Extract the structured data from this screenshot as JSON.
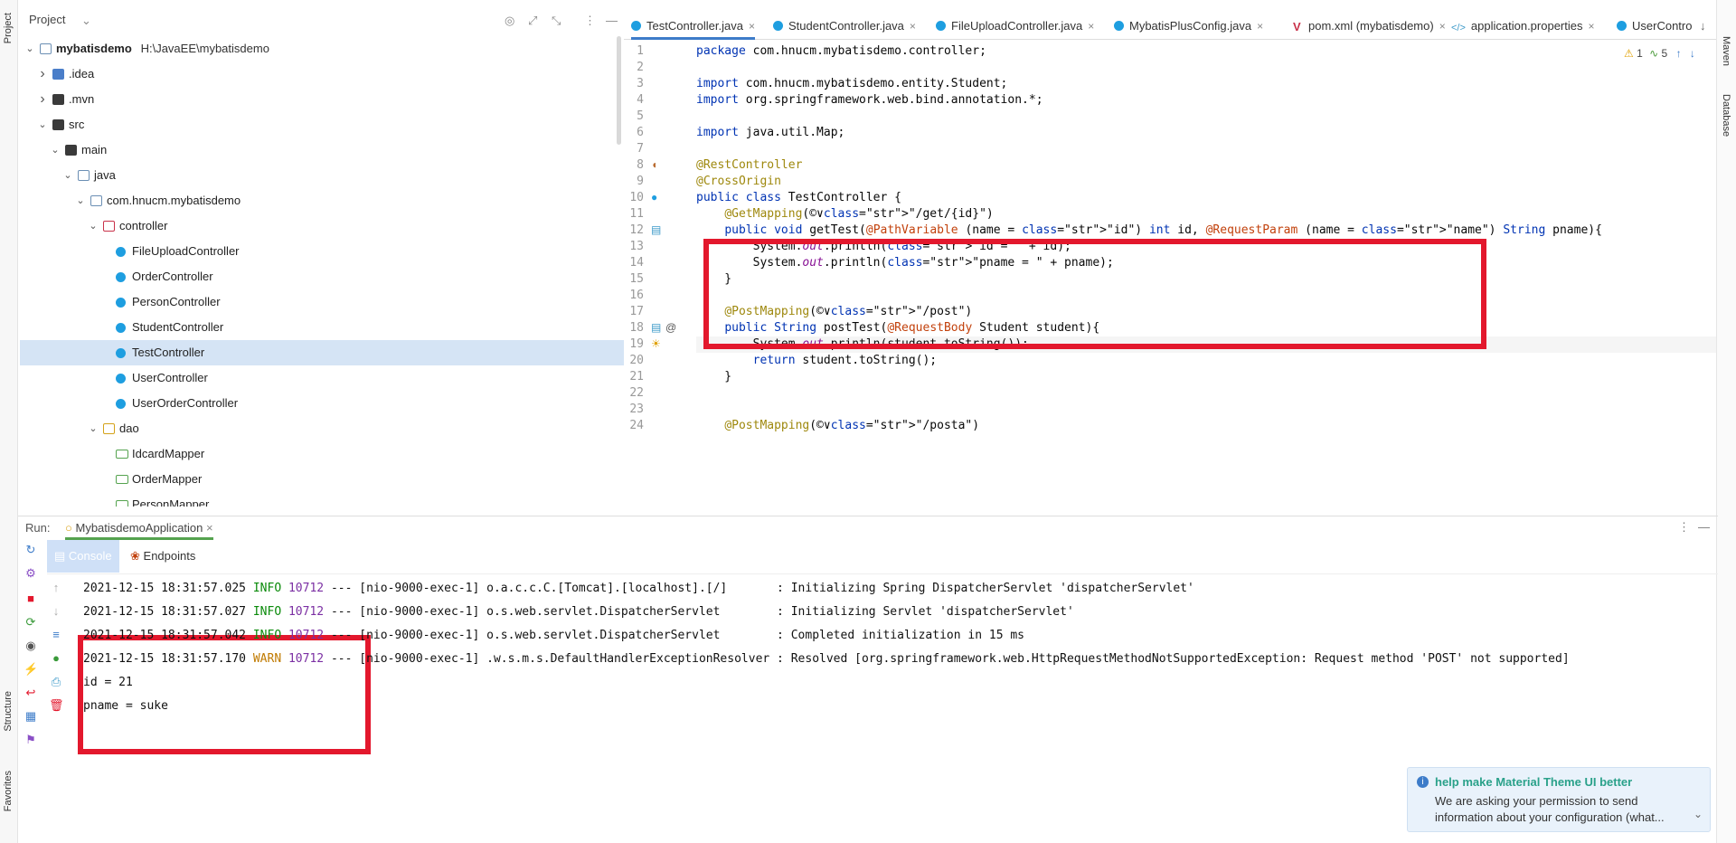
{
  "stripes": {
    "left": {
      "project": "Project",
      "structure": "Structure",
      "favorites": "Favorites"
    },
    "right": {
      "maven": "Maven",
      "database": "Database"
    }
  },
  "project_panel": {
    "title": "Project",
    "tree": [
      {
        "label": "mybatisdemo",
        "path": "H:\\JavaEE\\mybatisdemo",
        "icon": "module-folder-icon",
        "expanded": true,
        "depth": 0
      },
      {
        "label": ".idea",
        "icon": "folder-icon",
        "expanded": false,
        "depth": 1
      },
      {
        "label": ".mvn",
        "icon": "folder-icon",
        "expanded": false,
        "depth": 1
      },
      {
        "label": "src",
        "icon": "folder-icon",
        "expanded": true,
        "depth": 1
      },
      {
        "label": "main",
        "icon": "folder-icon",
        "expanded": true,
        "depth": 2
      },
      {
        "label": "java",
        "icon": "source-folder-icon",
        "expanded": true,
        "depth": 3
      },
      {
        "label": "com.hnucm.mybatisdemo",
        "icon": "package-icon",
        "expanded": true,
        "depth": 4
      },
      {
        "label": "controller",
        "icon": "package-icon",
        "expanded": true,
        "depth": 5
      },
      {
        "label": "FileUploadController",
        "icon": "class-icon",
        "depth": 6
      },
      {
        "label": "OrderController",
        "icon": "class-icon",
        "depth": 6
      },
      {
        "label": "PersonController",
        "icon": "class-icon",
        "depth": 6
      },
      {
        "label": "StudentController",
        "icon": "class-icon",
        "depth": 6
      },
      {
        "label": "TestController",
        "icon": "class-icon",
        "depth": 6,
        "selected": true
      },
      {
        "label": "UserController",
        "icon": "class-icon",
        "depth": 6
      },
      {
        "label": "UserOrderController",
        "icon": "class-icon",
        "depth": 6
      },
      {
        "label": "dao",
        "icon": "package-icon",
        "expanded": true,
        "depth": 5
      },
      {
        "label": "IdcardMapper",
        "icon": "interface-icon",
        "depth": 6
      },
      {
        "label": "OrderMapper",
        "icon": "interface-icon",
        "depth": 6
      },
      {
        "label": "PersonMapper",
        "icon": "interface-icon",
        "depth": 6
      }
    ]
  },
  "tabs": [
    {
      "label": "TestController.java",
      "active": true
    },
    {
      "label": "StudentController.java"
    },
    {
      "label": "FileUploadController.java"
    },
    {
      "label": "MybatisPlusConfig.java"
    },
    {
      "label": "pom.xml (mybatisdemo)"
    },
    {
      "label": "application.properties"
    },
    {
      "label": "UserContro"
    }
  ],
  "editor": {
    "status": {
      "warnings": "1",
      "weak_warnings": "5"
    },
    "current_line": "19",
    "lines": [
      {
        "n": "1",
        "text": "package com.hnucm.mybatisdemo.controller;"
      },
      {
        "n": "2",
        "text": ""
      },
      {
        "n": "3",
        "text": "import com.hnucm.mybatisdemo.entity.Student;"
      },
      {
        "n": "4",
        "text": "import org.springframework.web.bind.annotation.*;"
      },
      {
        "n": "5",
        "text": ""
      },
      {
        "n": "6",
        "text": "import java.util.Map;"
      },
      {
        "n": "7",
        "text": ""
      },
      {
        "n": "8",
        "text": "@RestController"
      },
      {
        "n": "9",
        "text": "@CrossOrigin"
      },
      {
        "n": "10",
        "text": "public class TestController {"
      },
      {
        "n": "11",
        "text": "    @GetMapping(©∨\"/get/{id}\")"
      },
      {
        "n": "12",
        "text": "    public void getTest(@PathVariable (name = \"id\") int id, @RequestParam (name = \"name\") String pname){"
      },
      {
        "n": "13",
        "text": "        System.out.println(\"id = \" + id);"
      },
      {
        "n": "14",
        "text": "        System.out.println(\"pname = \" + pname);"
      },
      {
        "n": "15",
        "text": "    }"
      },
      {
        "n": "16",
        "text": ""
      },
      {
        "n": "17",
        "text": "    @PostMapping(©∨\"/post\")"
      },
      {
        "n": "18",
        "text": "    public String postTest(@RequestBody Student student){"
      },
      {
        "n": "19",
        "text": "        System.out.println(student.toString());"
      },
      {
        "n": "20",
        "text": "        return student.toString();"
      },
      {
        "n": "21",
        "text": "    }"
      },
      {
        "n": "22",
        "text": ""
      },
      {
        "n": "23",
        "text": ""
      },
      {
        "n": "24",
        "text": "    @PostMapping(©∨\"/posta\")"
      }
    ]
  },
  "run_panel": {
    "label": "Run:",
    "config": "MybatisdemoApplication",
    "tabs": [
      {
        "label": "Console",
        "active": true
      },
      {
        "label": "Endpoints"
      }
    ],
    "console": [
      {
        "date": "2021-12-15 18:31:57.025",
        "level": "INFO",
        "pid": "10712",
        "sep": "---",
        "thread": "[nio-9000-exec-1]",
        "logger": "o.a.c.c.C.[Tomcat].[localhost].[/]      ",
        "msg": ": Initializing Spring DispatcherServlet 'dispatcherServlet'"
      },
      {
        "date": "2021-12-15 18:31:57.027",
        "level": "INFO",
        "pid": "10712",
        "sep": "---",
        "thread": "[nio-9000-exec-1]",
        "logger": "o.s.web.servlet.DispatcherServlet       ",
        "msg": ": Initializing Servlet 'dispatcherServlet'"
      },
      {
        "date": "2021-12-15 18:31:57.042",
        "level": "INFO",
        "pid": "10712",
        "sep": "---",
        "thread": "[nio-9000-exec-1]",
        "logger": "o.s.web.servlet.DispatcherServlet       ",
        "msg": ": Completed initialization in 15 ms"
      },
      {
        "date": "2021-12-15 18:31:57.170",
        "level": "WARN",
        "pid": "10712",
        "sep": "---",
        "thread": "[nio-9000-exec-1]",
        "logger": ".w.s.m.s.DefaultHandlerExceptionResolver",
        "msg": ": Resolved [org.springframework.web.HttpRequestMethodNotSupportedException: Request method 'POST' not supported]"
      },
      {
        "plain": "id = 21"
      },
      {
        "plain": "pname = suke"
      }
    ]
  },
  "notification": {
    "title": "help make Material Theme UI better",
    "body": "We are asking your permission to send information about your configuration (what..."
  }
}
